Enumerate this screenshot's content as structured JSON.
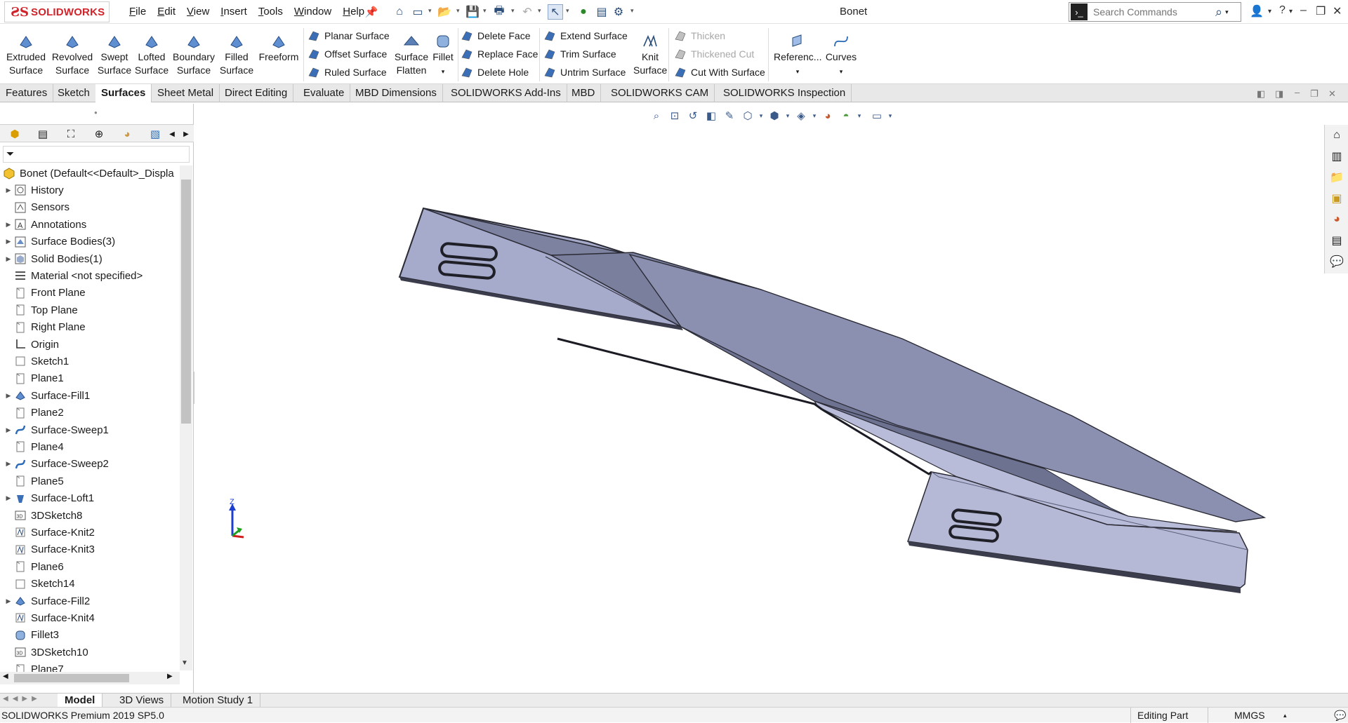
{
  "app": {
    "brand": "SOLIDWORKS",
    "doc_title": "Bonet"
  },
  "menu": [
    {
      "label": "File",
      "key": "F"
    },
    {
      "label": "Edit",
      "key": "E"
    },
    {
      "label": "View",
      "key": "V"
    },
    {
      "label": "Insert",
      "key": "I"
    },
    {
      "label": "Tools",
      "key": "T"
    },
    {
      "label": "Window",
      "key": "W"
    },
    {
      "label": "Help",
      "key": "H"
    }
  ],
  "search": {
    "placeholder": "Search Commands"
  },
  "ribbon": {
    "big": [
      {
        "line1": "Extruded",
        "line2": "Surface"
      },
      {
        "line1": "Revolved",
        "line2": "Surface"
      },
      {
        "line1": "Swept",
        "line2": "Surface"
      },
      {
        "line1": "Lofted",
        "line2": "Surface"
      },
      {
        "line1": "Boundary",
        "line2": "Surface"
      },
      {
        "line1": "Filled",
        "line2": "Surface"
      },
      {
        "line1": "Freeform",
        "line2": ""
      }
    ],
    "col1": [
      "Planar Surface",
      "Offset Surface",
      "Ruled Surface"
    ],
    "flatten": {
      "line1": "Surface",
      "line2": "Flatten"
    },
    "fillet": "Fillet",
    "col2": [
      "Delete Face",
      "Replace Face",
      "Delete Hole"
    ],
    "col3": [
      "Extend Surface",
      "Trim Surface",
      "Untrim Surface"
    ],
    "knit": {
      "line1": "Knit",
      "line2": "Surface"
    },
    "col4": [
      "Thicken",
      "Thickened Cut",
      "Cut With Surface"
    ],
    "reference": "Referenc...",
    "curves": "Curves"
  },
  "cmd_tabs": [
    "Features",
    "Sketch",
    "Surfaces",
    "Sheet Metal",
    "Direct Editing",
    "Evaluate",
    "MBD Dimensions",
    "SOLIDWORKS Add-Ins",
    "MBD",
    "SOLIDWORKS CAM",
    "SOLIDWORKS Inspection"
  ],
  "tree": {
    "root": "Bonet  (Default<<Default>_Displa",
    "items": [
      {
        "label": "History",
        "icon": "history-icon",
        "expandable": true
      },
      {
        "label": "Sensors",
        "icon": "sensors-icon",
        "expandable": false
      },
      {
        "label": "Annotations",
        "icon": "annotations-icon",
        "expandable": true
      },
      {
        "label": "Surface Bodies(3)",
        "icon": "surface-bodies-icon",
        "expandable": true
      },
      {
        "label": "Solid Bodies(1)",
        "icon": "solid-bodies-icon",
        "expandable": true
      },
      {
        "label": "Material <not specified>",
        "icon": "material-icon",
        "expandable": false
      },
      {
        "label": "Front Plane",
        "icon": "plane-icon",
        "expandable": false
      },
      {
        "label": "Top Plane",
        "icon": "plane-icon",
        "expandable": false
      },
      {
        "label": "Right Plane",
        "icon": "plane-icon",
        "expandable": false
      },
      {
        "label": "Origin",
        "icon": "origin-icon",
        "expandable": false
      },
      {
        "label": "Sketch1",
        "icon": "sketch-icon",
        "expandable": false
      },
      {
        "label": "Plane1",
        "icon": "plane-icon",
        "expandable": false
      },
      {
        "label": "Surface-Fill1",
        "icon": "surface-fill-icon",
        "expandable": true
      },
      {
        "label": "Plane2",
        "icon": "plane-icon",
        "expandable": false
      },
      {
        "label": "Surface-Sweep1",
        "icon": "sweep-icon",
        "expandable": true
      },
      {
        "label": "Plane4",
        "icon": "plane-icon",
        "expandable": false
      },
      {
        "label": "Surface-Sweep2",
        "icon": "sweep-icon",
        "expandable": true
      },
      {
        "label": "Plane5",
        "icon": "plane-icon",
        "expandable": false
      },
      {
        "label": "Surface-Loft1",
        "icon": "loft-icon",
        "expandable": true
      },
      {
        "label": "3DSketch8",
        "icon": "3dsketch-icon",
        "expandable": false
      },
      {
        "label": "Surface-Knit2",
        "icon": "knit-icon",
        "expandable": false
      },
      {
        "label": "Surface-Knit3",
        "icon": "knit-icon",
        "expandable": false
      },
      {
        "label": "Plane6",
        "icon": "plane-icon",
        "expandable": false
      },
      {
        "label": "Sketch14",
        "icon": "sketch-icon",
        "expandable": false
      },
      {
        "label": "Surface-Fill2",
        "icon": "surface-fill-icon",
        "expandable": true
      },
      {
        "label": "Surface-Knit4",
        "icon": "knit-icon",
        "expandable": false
      },
      {
        "label": "Fillet3",
        "icon": "fillet-icon",
        "expandable": false
      },
      {
        "label": "3DSketch10",
        "icon": "3dsketch-icon",
        "expandable": false
      },
      {
        "label": "Plane7",
        "icon": "plane-icon",
        "expandable": false
      }
    ]
  },
  "triad": {
    "z": "Z"
  },
  "bottom_tabs": [
    "Model",
    "3D Views",
    "Motion Study 1"
  ],
  "status": {
    "left": "SOLIDWORKS Premium 2019 SP5.0",
    "mode": "Editing Part",
    "units": "MMGS"
  },
  "colors": {
    "brand": "#d2232a",
    "part_face": "#9ea3c7",
    "part_dark": "#6f7491",
    "accent": "#2a4d7a"
  }
}
